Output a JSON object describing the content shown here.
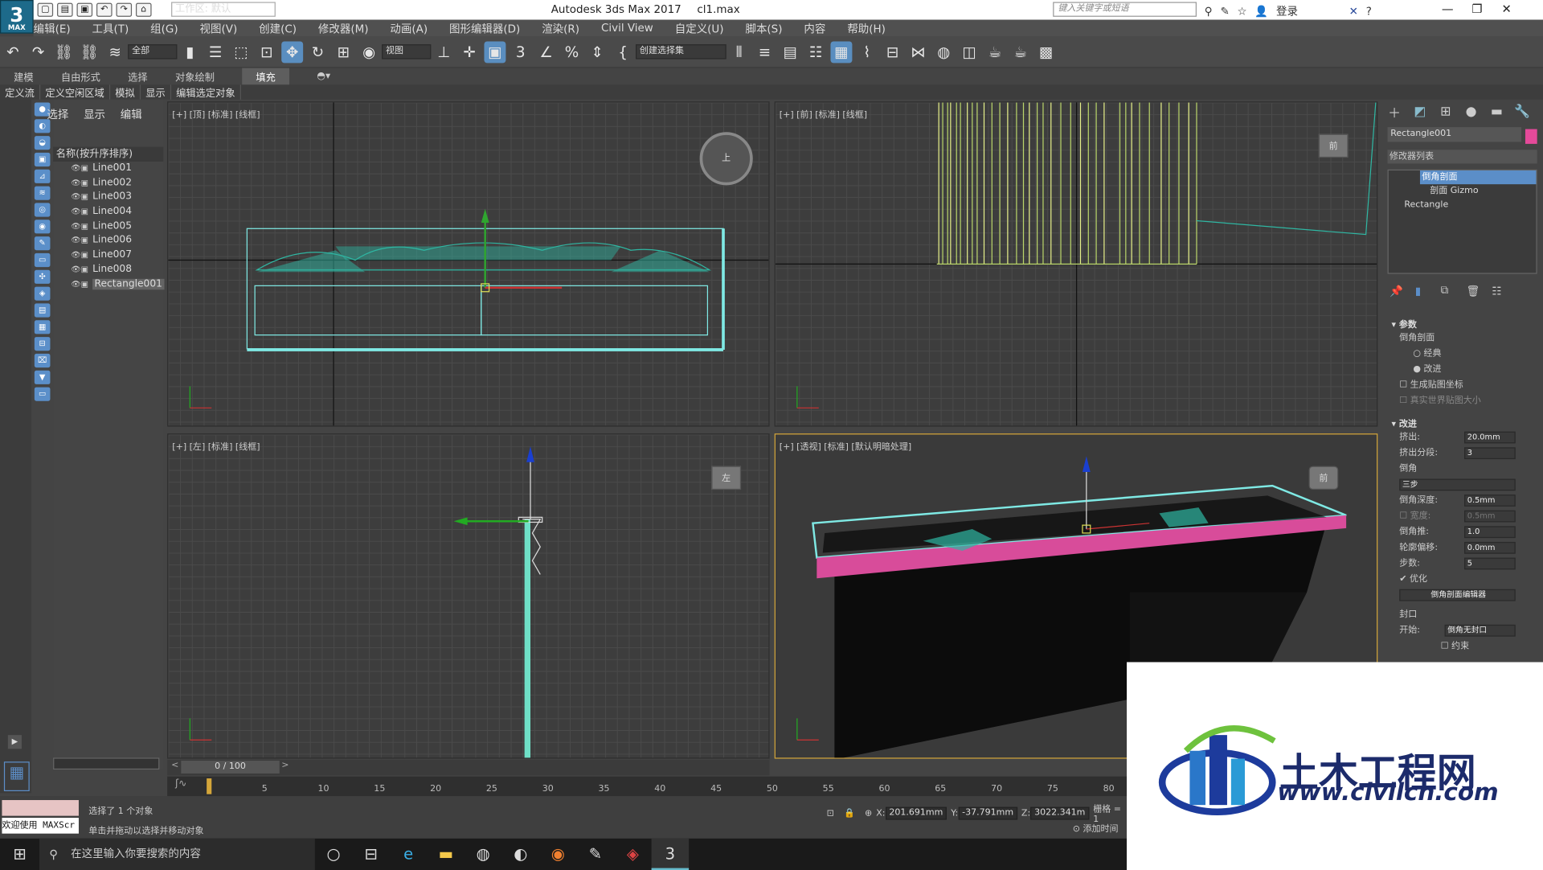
{
  "app": {
    "title": "Autodesk 3ds Max 2017",
    "file": "cl1.max",
    "logo": "3",
    "logo_sub": "MAX",
    "workspace": "工作区: 默认",
    "search_placeholder": "键入关键字或短语",
    "login": "登录"
  },
  "menu": [
    "编辑(E)",
    "工具(T)",
    "组(G)",
    "视图(V)",
    "创建(C)",
    "修改器(M)",
    "动画(A)",
    "图形编辑器(D)",
    "渲染(R)",
    "Civil View",
    "自定义(U)",
    "脚本(S)",
    "内容",
    "帮助(H)"
  ],
  "toolbar": {
    "filter": "全部",
    "refcoord": "视图",
    "selset": "创建选择集"
  },
  "ribbon_tabs": [
    "建模",
    "自由形式",
    "选择",
    "对象绘制",
    "填充"
  ],
  "ribbon_items": [
    "定义流",
    "定义空闲区域",
    "模拟",
    "显示",
    "编辑选定对象"
  ],
  "explorer": {
    "tabs": [
      "选择",
      "显示",
      "编辑"
    ],
    "column": "名称(按升序排序)",
    "items": [
      "Line001",
      "Line002",
      "Line003",
      "Line004",
      "Line005",
      "Line006",
      "Line007",
      "Line008",
      "Rectangle001"
    ],
    "selected": "Rectangle001"
  },
  "viewports": {
    "top": "[+] [顶] [标准] [线框]",
    "front": "[+] [前] [标准] [线框]",
    "left": "[+] [左] [标准] [线框]",
    "persp": "[+] [透视] [标准] [默认明暗处理]"
  },
  "cube_labels": {
    "top": "上",
    "front": "前",
    "left": "左",
    "persp": "前"
  },
  "command_panel": {
    "object_name": "Rectangle001",
    "object_color": "#e54a9a",
    "modifier_list": "修改器列表",
    "stack": [
      "倒角剖面",
      "剖面 Gizmo",
      "Rectangle"
    ],
    "params_title": "参数",
    "bevel_profile": "倒角剖面",
    "classic": "经典",
    "improved": "改进",
    "gen_map": "生成贴图坐标",
    "real_world": "真实世界贴图大小",
    "improved_title": "改进",
    "extrude_label": "挤出:",
    "extrude": "20.0mm",
    "segs_label": "挤出分段:",
    "segs": "3",
    "bevel_label": "倒角",
    "bevel_mode": "三步",
    "depth_label": "倒角深度:",
    "depth": "0.5mm",
    "width_label": "宽度:",
    "width": "0.5mm",
    "push_label": "倒角推:",
    "push": "1.0",
    "offset_label": "轮廓偏移:",
    "offset": "0.0mm",
    "steps_label": "步数:",
    "steps": "5",
    "optimize": "优化",
    "editor": "倒角剖面编辑器",
    "cap_title": "封口",
    "start_label": "开始:",
    "start": "倒角无封口",
    "constrain": "约束"
  },
  "timeline": {
    "frame": "0 / 100",
    "ticks": [
      "5",
      "10",
      "15",
      "20",
      "25",
      "30",
      "35",
      "40",
      "45",
      "50",
      "55",
      "60",
      "65",
      "70",
      "75",
      "80"
    ]
  },
  "status": {
    "welcome": "欢迎使用 MAXScr",
    "selected": "选择了 1 个对象",
    "hint": "单击并拖动以选择并移动对象",
    "x_label": "X:",
    "x": "201.691mm",
    "y_label": "Y:",
    "y": "-37.791mm",
    "z_label": "Z:",
    "z": "3022.341m",
    "grid": "栅格 = 1",
    "addtime": "添加时间"
  },
  "taskbar": {
    "search": "在这里输入你要搜索的内容"
  },
  "watermark": {
    "title": "土木工程网",
    "url": "www.civilcn.com"
  }
}
